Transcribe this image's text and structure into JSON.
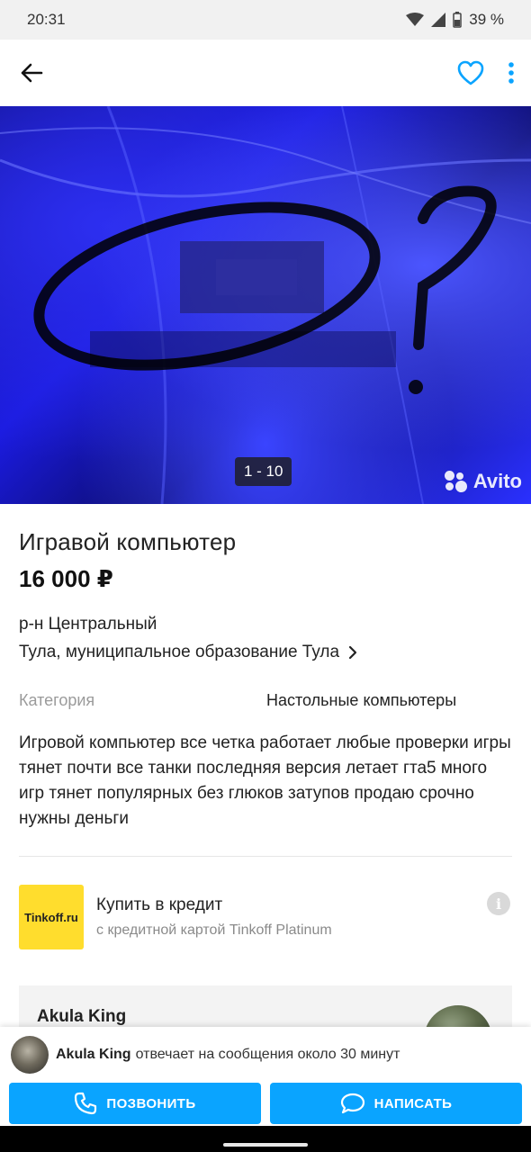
{
  "status_bar": {
    "time": "20:31",
    "battery": "39 %"
  },
  "app_bar": {
    "back_icon": "arrow-left-icon",
    "favorite_icon": "heart-outline-icon",
    "menu_icon": "more-vert-icon",
    "accent_color": "#0aa4ff"
  },
  "gallery": {
    "counter": "1 - 10",
    "watermark": "Avito"
  },
  "listing": {
    "title": "Игравой компьютер",
    "price": "16 000 ₽",
    "district": "р-н Центральный",
    "address": "Тула, муниципальное образование Тула",
    "category_label": "Категория",
    "category_value": "Настольные компьютеры",
    "description": "Игровой компьютер все четка работает любые проверки игры тянет почти все танки последняя версия летает гта5 много игр тянет популярных без глюков затупов продаю срочно нужны деньги"
  },
  "credit": {
    "logo_text": "Tinkoff.ru",
    "title": "Купить в кредит",
    "subtitle": "с кредитной картой Tinkoff Platinum",
    "info_icon": "info-icon"
  },
  "seller": {
    "name": "Akula King"
  },
  "bottom": {
    "seller_name": "Akula King",
    "reply_text": "отвечает на сообщения около 30 минут",
    "call_label": "ПОЗВОНИТЬ",
    "write_label": "НАПИСАТЬ"
  }
}
